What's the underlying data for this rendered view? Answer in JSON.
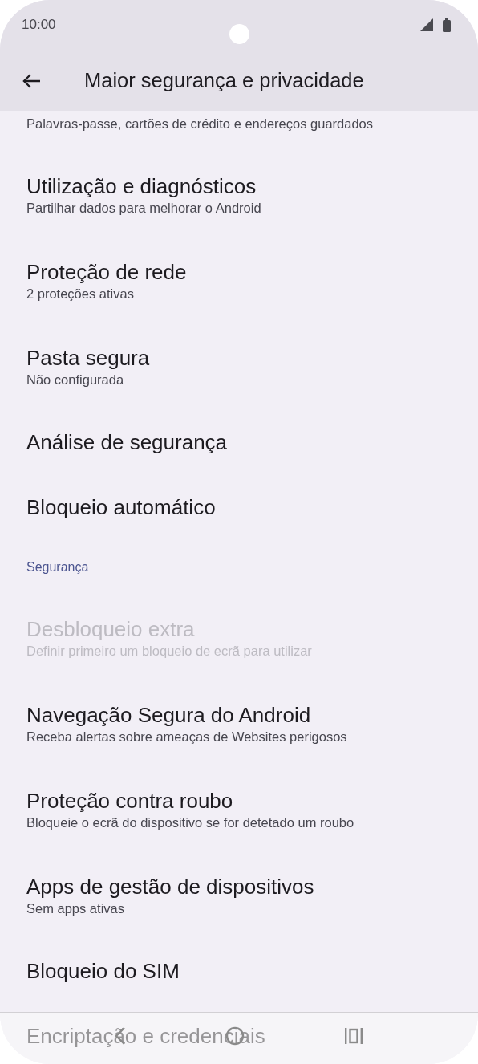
{
  "status_bar": {
    "time": "10:00"
  },
  "app_bar": {
    "title": "Maior segurança e privacidade"
  },
  "list": [
    {
      "kind": "setting",
      "subtitle": "Palavras-passe, cartões de crédito e endereços guardados",
      "disabled": false
    },
    {
      "kind": "setting",
      "title": "Utilização e diagnósticos",
      "subtitle": "Partilhar dados para melhorar o Android",
      "disabled": false
    },
    {
      "kind": "setting",
      "title": "Proteção de rede",
      "subtitle": "2 proteções ativas",
      "disabled": false
    },
    {
      "kind": "setting",
      "title": "Pasta segura",
      "subtitle": "Não configurada",
      "disabled": false
    },
    {
      "kind": "setting",
      "title": "Análise de segurança",
      "disabled": false
    },
    {
      "kind": "setting",
      "title": "Bloqueio automático",
      "disabled": false
    },
    {
      "kind": "section_header",
      "title": "Segurança"
    },
    {
      "kind": "setting",
      "title": "Desbloqueio extra",
      "subtitle": "Definir primeiro um bloqueio de ecrã para utilizar",
      "disabled": true
    },
    {
      "kind": "setting",
      "title": "Navegação Segura do Android",
      "subtitle": "Receba alertas sobre ameaças de Websites perigosos",
      "disabled": false
    },
    {
      "kind": "setting",
      "title": "Proteção contra roubo",
      "subtitle": "Bloqueie o ecrã do dispositivo se for detetado um roubo",
      "disabled": false
    },
    {
      "kind": "setting",
      "title": "Apps de gestão de dispositivos",
      "subtitle": "Sem apps ativas",
      "disabled": false
    },
    {
      "kind": "setting",
      "title": "Bloqueio do SIM",
      "disabled": false
    },
    {
      "kind": "setting",
      "title": "Encriptação e credenciais",
      "disabled": false
    }
  ]
}
